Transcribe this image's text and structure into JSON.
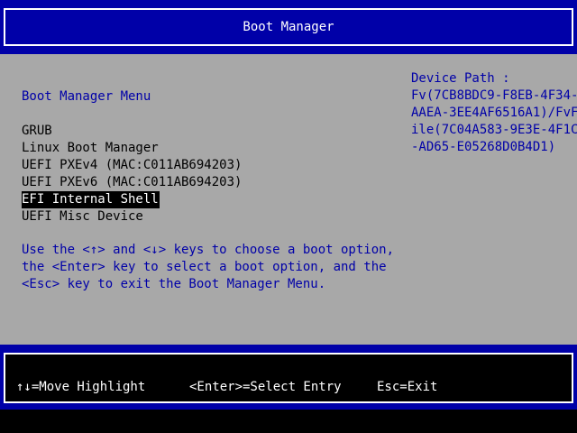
{
  "header": {
    "title": "Boot Manager"
  },
  "menu": {
    "title": "Boot Manager Menu",
    "entries": [
      {
        "label": "GRUB"
      },
      {
        "label": "Linux Boot Manager"
      },
      {
        "label": "UEFI PXEv4 (MAC:C011AB694203)"
      },
      {
        "label": "UEFI PXEv6 (MAC:C011AB694203)"
      },
      {
        "label": "EFI Internal Shell"
      },
      {
        "label": "UEFI Misc Device"
      }
    ],
    "selected_index": 4
  },
  "help": {
    "lines": [
      "Use the <↑> and <↓> keys to choose a boot option,",
      "the <Enter> key to select a boot option, and the",
      "<Esc> key to exit the Boot Manager Menu."
    ]
  },
  "device_path": {
    "lines": [
      "Device Path :",
      "Fv(7CB8BDC9-F8EB-4F34-",
      "AAEA-3EE4AF6516A1)/FvF",
      "ile(7C04A583-9E3E-4F1C",
      "-AD65-E05268D0B4D1)"
    ]
  },
  "footer": {
    "move": "↑↓=Move Highlight",
    "enter": "<Enter>=Select Entry",
    "esc": "Esc=Exit"
  },
  "colors": {
    "background": "#a8a8a8",
    "bar": "#0000a8",
    "text_blue": "#0000a8",
    "highlight_bg": "#000000",
    "highlight_fg": "#ffffff"
  }
}
